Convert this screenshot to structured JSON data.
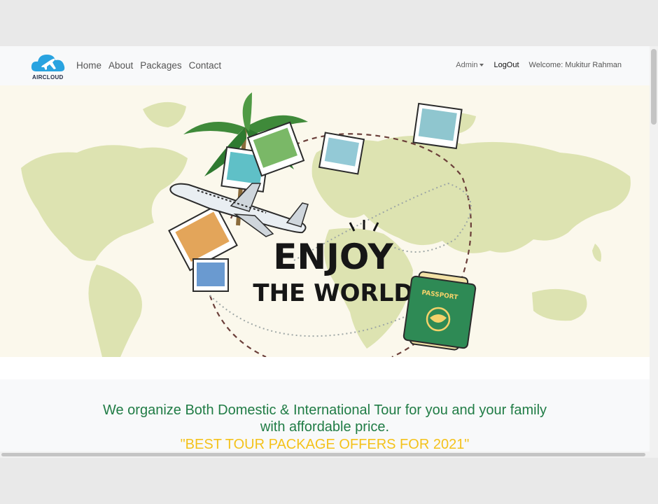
{
  "brand": {
    "name": "AIRCLOUD",
    "logo_icon": "cloud-plane-icon",
    "color": "#29a3e0"
  },
  "nav": {
    "links": [
      "Home",
      "About",
      "Packages",
      "Contact"
    ],
    "admin_label": "Admin",
    "logout_label": "LogOut",
    "welcome_text": "Welcome: Mukitur Rahman"
  },
  "hero": {
    "headline_line1": "ENJOY",
    "headline_line2": "THE WORLD",
    "passport_label": "PASSPORT",
    "map_color": "#dde3b1",
    "background_color": "#fbf8ec"
  },
  "info": {
    "tagline_line1": "We organize Both Domestic & International Tour for you and your family",
    "tagline_line2": "with affordable price.",
    "offer_text": "\"BEST TOUR PACKAGE OFFERS FOR 2021\"",
    "tagline_color": "#207c45",
    "offer_color": "#f4c21b"
  }
}
